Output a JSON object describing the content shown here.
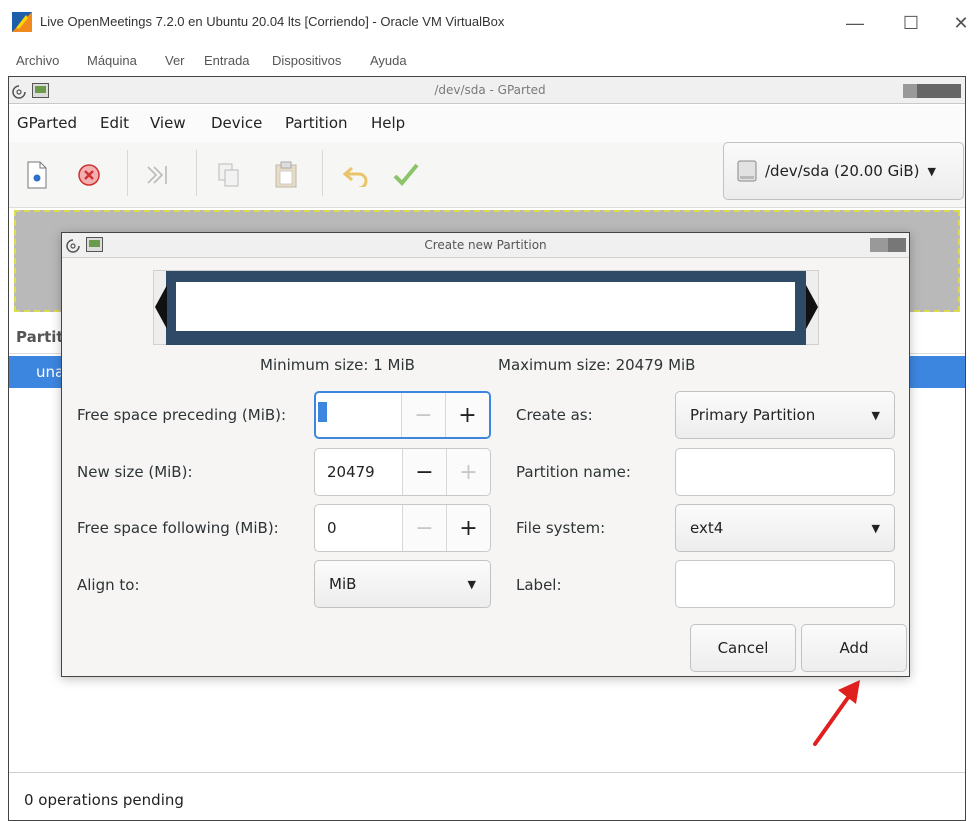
{
  "vbox": {
    "title": "Live OpenMeetings 7.2.0 en Ubuntu 20.04 lts [Corriendo] - Oracle VM VirtualBox",
    "controls": {
      "minimize": "—",
      "maximize": "☐",
      "close": "✕"
    },
    "menu": [
      "Archivo",
      "Máquina",
      "Ver",
      "Entrada",
      "Dispositivos",
      "Ayuda"
    ]
  },
  "gparted": {
    "title": "/dev/sda - GParted",
    "menu": [
      "GParted",
      "Edit",
      "View",
      "Device",
      "Partition",
      "Help"
    ],
    "device": "/dev/sda (20.00 GiB)",
    "list_header": "Partiti",
    "selected_row": "unal",
    "status": "0 operations pending"
  },
  "dialog": {
    "title": "Create new Partition",
    "min_size": "Minimum size: 1 MiB",
    "max_size": "Maximum size: 20479 MiB",
    "free_preceding": {
      "label": "Free space preceding (MiB):",
      "value": "1"
    },
    "new_size": {
      "label": "New size (MiB):",
      "value": "20479"
    },
    "free_following": {
      "label": "Free space following (MiB):",
      "value": "0"
    },
    "align_to": {
      "label": "Align to:",
      "value": "MiB"
    },
    "create_as": {
      "label": "Create as:",
      "value": "Primary Partition"
    },
    "partition_name": {
      "label": "Partition name:",
      "value": ""
    },
    "file_system": {
      "label": "File system:",
      "value": "ext4"
    },
    "fs_label": {
      "label": "Label:",
      "value": ""
    },
    "cancel": "Cancel",
    "add": "Add"
  },
  "spin_symbols": {
    "minus": "−",
    "plus": "+"
  },
  "colors": {
    "selection": "#3d86e0",
    "graph_border": "#2f4a66",
    "arrow": "#e0201e"
  }
}
